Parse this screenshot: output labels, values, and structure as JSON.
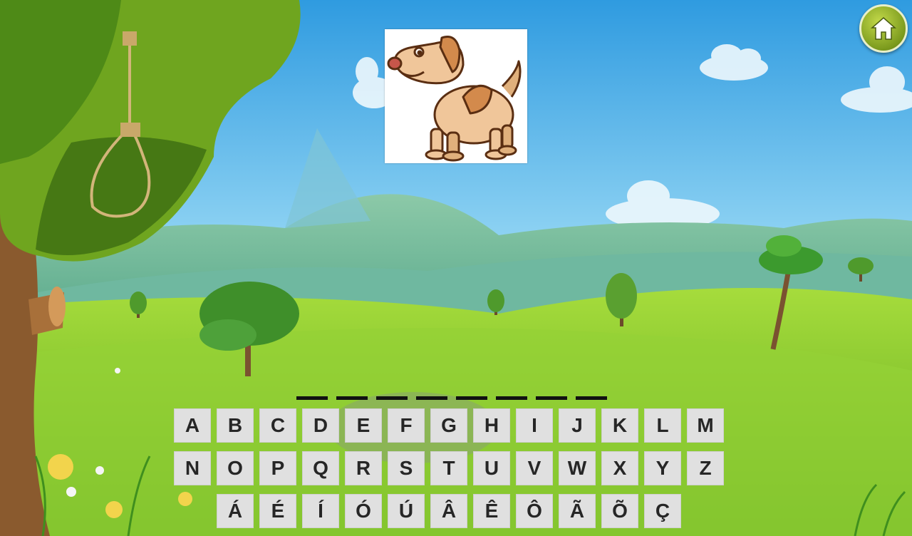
{
  "game": {
    "picture_icon": "dog-icon",
    "home_icon": "home-icon",
    "word_length": 8,
    "letters_row1": [
      "A",
      "B",
      "C",
      "D",
      "E",
      "F",
      "G",
      "H",
      "I",
      "J",
      "K",
      "L",
      "M"
    ],
    "letters_row2": [
      "N",
      "O",
      "P",
      "Q",
      "R",
      "S",
      "T",
      "U",
      "V",
      "W",
      "X",
      "Y",
      "Z"
    ],
    "letters_row3": [
      "Á",
      "É",
      "Í",
      "Ó",
      "Ú",
      "Â",
      "Ê",
      "Ô",
      "Ã",
      "Õ",
      "Ç"
    ]
  },
  "colors": {
    "sky_top": "#3fa6e6",
    "grass": "#8ccf2e",
    "key_bg": "#e0e0e0",
    "home_button": "#8fb027"
  }
}
